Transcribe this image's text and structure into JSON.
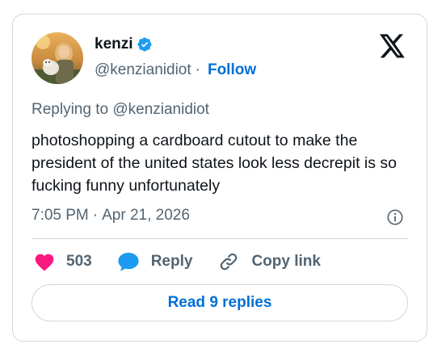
{
  "author": {
    "display_name": "kenzi",
    "handle": "@kenzianidiot",
    "separator": "·",
    "follow_label": "Follow"
  },
  "reply_context": "Replying to @kenzianidiot",
  "tweet": {
    "text": "photoshopping a cardboard cutout to make the president of the united states look less decrepit is so fucking funny unfortunately",
    "time": "7:05 PM",
    "separator": "·",
    "date": "Apr 21, 2026"
  },
  "actions": {
    "like_count": "503",
    "reply_label": "Reply",
    "copy_link_label": "Copy link"
  },
  "read_replies_label": "Read 9 replies",
  "icons": {
    "verified": "verified-badge-icon",
    "x_logo": "x-logo-icon",
    "info": "info-icon",
    "heart": "heart-icon",
    "reply": "reply-bubble-icon",
    "link": "link-icon"
  },
  "colors": {
    "accent": "#006fd6",
    "verified": "#1d9bf0",
    "like": "#f91880",
    "muted": "#536471",
    "text": "#0f1419",
    "border": "#cfd9de"
  }
}
